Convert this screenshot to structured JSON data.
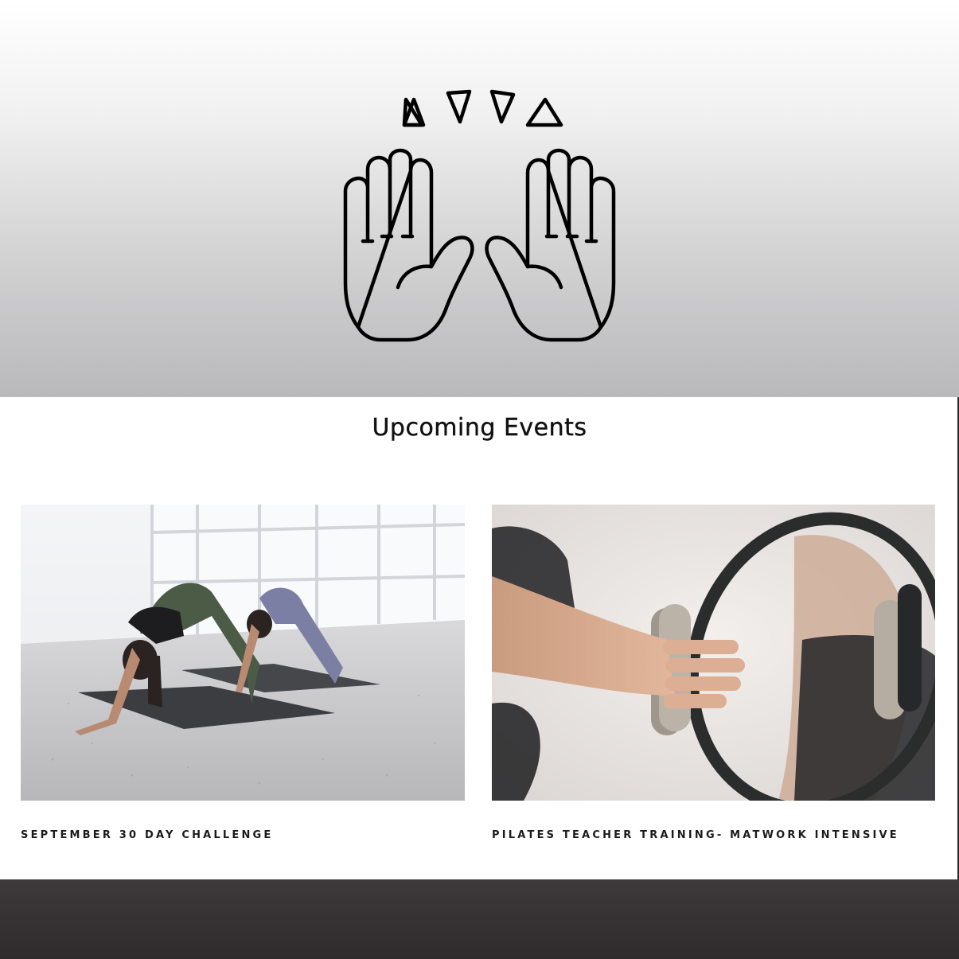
{
  "hero": {
    "icon": "raised-hands-icon",
    "background_top": "#ffffff",
    "background_bottom": "#b9b8ba"
  },
  "section": {
    "title": "Upcoming Events"
  },
  "events": [
    {
      "title": "SEPTEMBER 30 DAY CHALLENGE",
      "image": "yoga-downward-dog-photo"
    },
    {
      "title": "PILATES TEACHER TRAINING- MATWORK INTENSIVE",
      "image": "pilates-ring-photo"
    }
  ],
  "footer": {
    "background": "#3a3637"
  }
}
